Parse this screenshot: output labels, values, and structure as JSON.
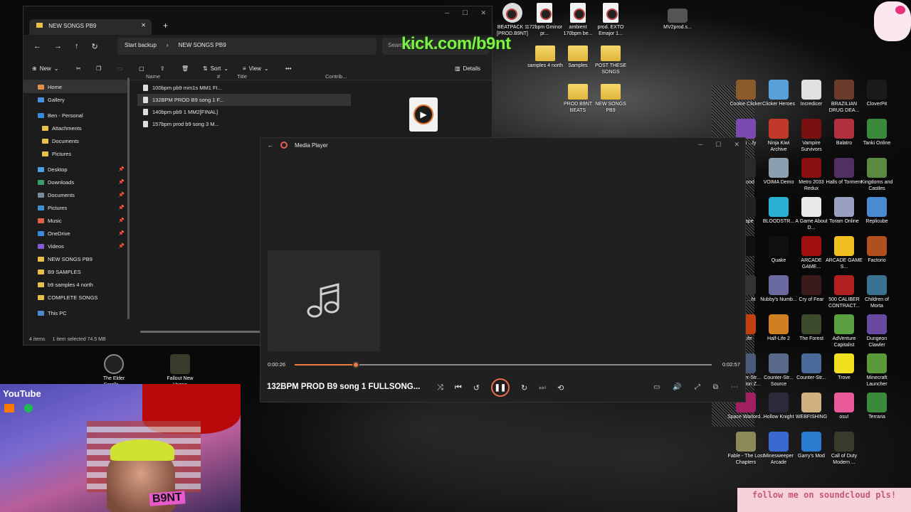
{
  "overlay": {
    "kick_url": "kick.com/b9nt",
    "youtube": "YouTube",
    "soundcloud_banner": "follow me on soundcloud pls!",
    "webcam_name": "B9NT"
  },
  "desktop_icons_top": [
    {
      "label": "BEATPACK 1 [PROD.B9NT]"
    },
    {
      "label": "172bpm Gminor pr..."
    },
    {
      "label": "ambient 170bpm be..."
    },
    {
      "label": "prod. EXTO Emajor 1..."
    },
    {
      "label": "MV2prod.s..."
    }
  ],
  "desktop_folders": [
    {
      "label": "samples 4 north"
    },
    {
      "label": "Samples"
    },
    {
      "label": "POST THESE SONGS"
    },
    {
      "label": "PROD B9NT BEATS"
    },
    {
      "label": "NEW SONGS PB9"
    }
  ],
  "desktop_right_icons": [
    {
      "label": "Cookie Clicker",
      "color": "#8b5a2b"
    },
    {
      "label": "Clicker Heroes",
      "color": "#5aa0d8"
    },
    {
      "label": "Incredicer",
      "color": "#e0e0e0"
    },
    {
      "label": "BRAZILIAN DRUG DEA...",
      "color": "#6a3a2a"
    },
    {
      "label": "CloverPit",
      "color": "#1a1a1a"
    },
    {
      "label": "...ten ...fy",
      "color": "#7a4ab0"
    },
    {
      "label": "Ninja Kiwi Archive",
      "color": "#c0392b"
    },
    {
      "label": "Vampire Survivors",
      "color": "#7a1010"
    },
    {
      "label": "Balatro",
      "color": "#b03040"
    },
    {
      "label": "Tanki Online",
      "color": "#3a8a3a"
    },
    {
      "label": "...Blood",
      "color": "#2a2a2a"
    },
    {
      "label": "VOIMA Demo",
      "color": "#8aa0b0"
    },
    {
      "label": "Metro 2033 Redux",
      "color": "#8a1010"
    },
    {
      "label": "Halls of Torment",
      "color": "#503060"
    },
    {
      "label": "Kingdoms and Castles",
      "color": "#5a8a40"
    },
    {
      "label": "...cape",
      "color": "#222"
    },
    {
      "label": "BLOODSTR...",
      "color": "#2ab0d0"
    },
    {
      "label": "A Game About D...",
      "color": "#e8e8e8"
    },
    {
      "label": "Toram Online",
      "color": "#9aa0c0"
    },
    {
      "label": "Replicube",
      "color": "#4a8ad0"
    },
    {
      "label": "...",
      "color": "#111"
    },
    {
      "label": "Quake",
      "color": "#111"
    },
    {
      "label": "ARCADE GAME...",
      "color": "#a01010"
    },
    {
      "label": "ARCADE GAME S...",
      "color": "#f0c020"
    },
    {
      "label": "Factorio",
      "color": "#b05020"
    },
    {
      "label": "...dy ...ht",
      "color": "#333"
    },
    {
      "label": "Nubby's Numb...",
      "color": "#6a6aa0"
    },
    {
      "label": "Cry of Fear",
      "color": "#3a1a1a"
    },
    {
      "label": "500 CALIBER CONTRACT...",
      "color": "#b02020"
    },
    {
      "label": "Children of Morta",
      "color": "#3a7090"
    },
    {
      "label": "...Life",
      "color": "#c04010"
    },
    {
      "label": "Half-Life 2",
      "color": "#d08020"
    },
    {
      "label": "The Forest",
      "color": "#3a4a2a"
    },
    {
      "label": "AdVenture Capitalist",
      "color": "#5aa040"
    },
    {
      "label": "Dungeon Clawler",
      "color": "#6a4aa0"
    },
    {
      "label": "Counter-Str... Condition Z...",
      "color": "#4a5a7a"
    },
    {
      "label": "Counter-Str... Source",
      "color": "#5a6a8a"
    },
    {
      "label": "Counter-Str...",
      "color": "#4a6a9a"
    },
    {
      "label": "Trove",
      "color": "#f0e020"
    },
    {
      "label": "Minecraft Launcher",
      "color": "#5a9a3a"
    },
    {
      "label": "Space Warlord...",
      "color": "#a02060"
    },
    {
      "label": "Hollow Knight",
      "color": "#2a2a3a"
    },
    {
      "label": "WEBFISHING",
      "color": "#d0b080"
    },
    {
      "label": "osu!",
      "color": "#ea5a9a"
    },
    {
      "label": "Terraria",
      "color": "#3a8a3a"
    },
    {
      "label": "Fable - The Lost Chapters",
      "color": "#8a8a5a"
    },
    {
      "label": "Minesweeper Arcade",
      "color": "#3a6ad0"
    },
    {
      "label": "Garry's Mod",
      "color": "#2a7ad0"
    },
    {
      "label": "Call of Duty Modern ...",
      "color": "#3a3a2a"
    }
  ],
  "desktop_bottom_icons": [
    {
      "label": "The Elder Scrolls ..."
    },
    {
      "label": "Fallout New Vegas"
    }
  ],
  "explorer": {
    "tab_title": "NEW SONGS PB9",
    "new_tab": "+",
    "breadcrumb_root": "Start backup",
    "breadcrumb_current": "NEW SONGS PB9",
    "search_placeholder": "Search NE...",
    "cmd": {
      "new": "New",
      "sort": "Sort",
      "view": "View",
      "details": "Details"
    },
    "nav": [
      {
        "label": "Home",
        "kind": "home",
        "selected": true
      },
      {
        "label": "Gallery",
        "kind": "gallery"
      },
      {
        "label": "Ben - Personal",
        "kind": "cloud"
      },
      {
        "label": "Attachments",
        "kind": "folder",
        "indent": 1
      },
      {
        "label": "Documents",
        "kind": "folder",
        "indent": 1
      },
      {
        "label": "Pictures",
        "kind": "folder",
        "indent": 1
      },
      {
        "label": "Desktop",
        "kind": "desk",
        "pinned": true
      },
      {
        "label": "Downloads",
        "kind": "dl",
        "pinned": true
      },
      {
        "label": "Documents",
        "kind": "doc",
        "pinned": true
      },
      {
        "label": "Pictures",
        "kind": "pic",
        "pinned": true
      },
      {
        "label": "Music",
        "kind": "music",
        "pinned": true
      },
      {
        "label": "OneDrive",
        "kind": "cloud",
        "pinned": true
      },
      {
        "label": "Videos",
        "kind": "video",
        "pinned": true
      },
      {
        "label": "NEW SONGS PB9",
        "kind": "folder"
      },
      {
        "label": "B9 SAMPLES",
        "kind": "folder"
      },
      {
        "label": "b9 samples 4 north",
        "kind": "folder"
      },
      {
        "label": "COMPLETE SONGS",
        "kind": "folder"
      },
      {
        "label": "This PC",
        "kind": "pc"
      }
    ],
    "columns": [
      "Name",
      "#",
      "Title",
      "Contrib..."
    ],
    "files": [
      {
        "name": "100bpm pb9 mm1s MM1 FI..."
      },
      {
        "name": "132BPM PROD B9 song 1 F...",
        "selected": true
      },
      {
        "name": "140bpm pb9 1 MM2[FINAL]"
      },
      {
        "name": "157bpm prod b9 song 3 M..."
      }
    ],
    "status_items": "4 items",
    "status_selected": "1 item selected  74.5 MB"
  },
  "player": {
    "title": "Media Player",
    "elapsed": "0:00:26",
    "duration": "0:02:57",
    "progress_fraction": 0.147,
    "song_title": "132BPM PROD B9 song 1 FULLSONG...",
    "accent": "#f07c3a"
  }
}
